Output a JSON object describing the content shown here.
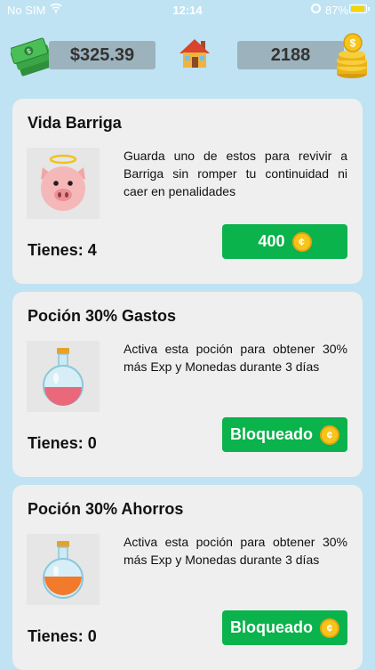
{
  "status_bar": {
    "carrier": "No SIM",
    "time": "12:14",
    "battery": "87%",
    "battery_level": 0.87
  },
  "header": {
    "money": "$325.39",
    "coins": "2188"
  },
  "items": [
    {
      "title": "Vida Barriga",
      "description": "Guarda uno de estos para revivir a Barriga sin romper tu continuidad ni caer en penalidades",
      "have": "Tienes: 4",
      "button": "400",
      "icon": "angel-pig-icon"
    },
    {
      "title": "Poción 30% Gastos",
      "description": "Activa esta poción para obtener 30% más Exp y Monedas durante 3 días",
      "have": "Tienes: 0",
      "button": "Bloqueado",
      "icon": "red-potion-icon"
    },
    {
      "title": "Poción 30% Ahorros",
      "description": "Activa esta poción para obtener 30% más Exp y Monedas durante 3 días",
      "have": "Tienes: 0",
      "button": "Bloqueado",
      "icon": "orange-potion-icon"
    }
  ],
  "coin_symbol": "¢",
  "colors": {
    "background": "#bfe3f3",
    "button": "#0ab34b",
    "pill": "#9cb2bd",
    "card": "#efefef"
  }
}
